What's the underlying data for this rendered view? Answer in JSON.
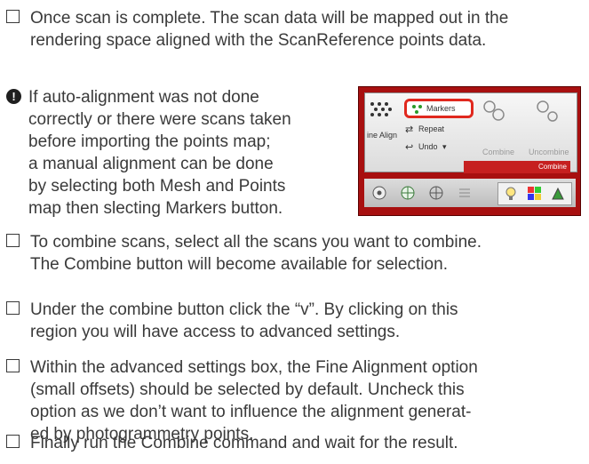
{
  "steps": [
    {
      "lines": [
        "Once scan is complete. The scan data will be mapped out in the",
        "rendering space aligned with the ScanReference points data."
      ]
    },
    {
      "lines": [
        "To combine scans, select all the scans you want to combine.",
        "The Combine button will become available for selection."
      ]
    },
    {
      "lines": [
        "Under the combine button click the “v”. By clicking on this",
        "region you will have access to advanced settings."
      ]
    },
    {
      "lines": [
        "Within the advanced settings box, the Fine Alignment option",
        "(small offsets) should be selected by default. Uncheck this",
        "option as we don’t want to influence the alignment generat-",
        "ed by photogrammetry points."
      ]
    },
    {
      "lines": [
        "Finally run the Combine command and wait for the result."
      ]
    }
  ],
  "note": {
    "icon": "exclamation-circle-icon",
    "lines": [
      "If auto-alignment was not done",
      "correctly or there were scans taken",
      "before importing the points map;",
      "a manual alignment can be done",
      "by selecting both Mesh and Points",
      "map then slecting Markers button."
    ]
  },
  "toolbar_image": {
    "markers_label": "Markers",
    "repeat_label": "Repeat",
    "undo_label": "Undo",
    "fine_align_label": "ine Align",
    "combine_label": "Combine",
    "uncombine_label": "Uncombine",
    "group_label": "Combine",
    "highlight_color": "#e0281e"
  }
}
